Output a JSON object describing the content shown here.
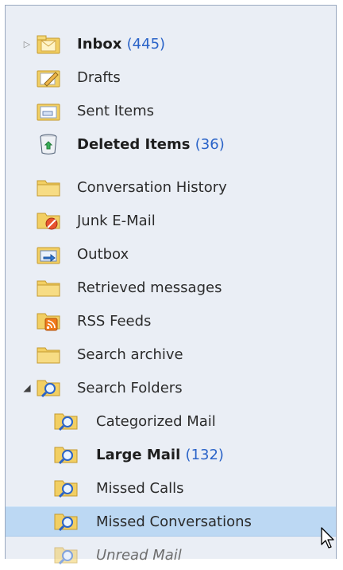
{
  "folders": {
    "inbox": {
      "label": "Inbox",
      "count": "(445)",
      "icon": "inbox-icon"
    },
    "drafts": {
      "label": "Drafts",
      "icon": "drafts-icon"
    },
    "sent": {
      "label": "Sent Items",
      "icon": "sent-items-icon"
    },
    "deleted": {
      "label": "Deleted Items",
      "count": "(36)",
      "icon": "deleted-items-icon"
    },
    "conversation_history": {
      "label": "Conversation History",
      "icon": "folder-icon"
    },
    "junk": {
      "label": "Junk E-Mail",
      "icon": "junk-mail-icon"
    },
    "outbox": {
      "label": "Outbox",
      "icon": "outbox-icon"
    },
    "retrieved": {
      "label": "Retrieved messages",
      "icon": "folder-icon"
    },
    "rss": {
      "label": "RSS Feeds",
      "icon": "rss-feeds-icon"
    },
    "search_archive": {
      "label": "Search archive",
      "icon": "folder-icon"
    },
    "search_folders": {
      "label": "Search Folders",
      "icon": "search-folder-icon"
    },
    "categorized": {
      "label": "Categorized Mail",
      "icon": "search-folder-icon"
    },
    "large_mail": {
      "label": "Large Mail",
      "count": "(132)",
      "icon": "search-folder-icon"
    },
    "missed_calls": {
      "label": "Missed Calls",
      "icon": "search-folder-icon"
    },
    "missed_conversations": {
      "label": "Missed Conversations",
      "icon": "search-folder-icon"
    },
    "unread_mail": {
      "label": "Unread Mail",
      "icon": "search-folder-icon"
    }
  },
  "selected": "Missed Conversations",
  "colors": {
    "pane_bg": "#eaeef5",
    "selected_bg": "#bcd8f3",
    "count_text": "#2a63c8"
  }
}
